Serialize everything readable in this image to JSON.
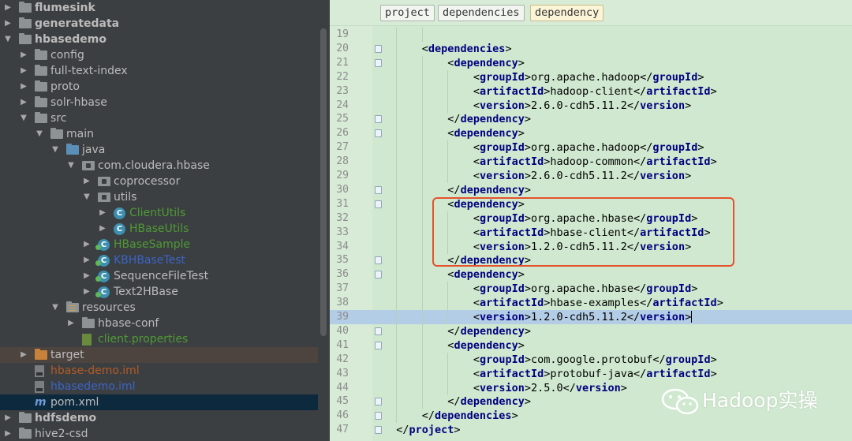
{
  "project_tree": {
    "items": [
      {
        "label": "flumesink",
        "depth": 0,
        "icon": "module-folder-icon",
        "expanded": false,
        "bold": true
      },
      {
        "label": "generatedata",
        "depth": 0,
        "icon": "module-folder-icon",
        "expanded": false,
        "bold": true
      },
      {
        "label": "hbasedemo",
        "depth": 0,
        "icon": "module-folder-icon",
        "expanded": true,
        "bold": true
      },
      {
        "label": "config",
        "depth": 1,
        "icon": "folder-icon",
        "expanded": false
      },
      {
        "label": "full-text-index",
        "depth": 1,
        "icon": "folder-icon",
        "expanded": false
      },
      {
        "label": "proto",
        "depth": 1,
        "icon": "folder-icon",
        "expanded": false
      },
      {
        "label": "solr-hbase",
        "depth": 1,
        "icon": "folder-icon",
        "expanded": false
      },
      {
        "label": "src",
        "depth": 1,
        "icon": "folder-icon",
        "expanded": true
      },
      {
        "label": "main",
        "depth": 2,
        "icon": "folder-icon",
        "expanded": true
      },
      {
        "label": "java",
        "depth": 3,
        "icon": "source-folder-icon",
        "expanded": true
      },
      {
        "label": "com.cloudera.hbase",
        "depth": 4,
        "icon": "package-icon",
        "expanded": true
      },
      {
        "label": "coprocessor",
        "depth": 5,
        "icon": "package-icon",
        "expanded": false
      },
      {
        "label": "utils",
        "depth": 5,
        "icon": "package-icon",
        "expanded": true
      },
      {
        "label": "ClientUtils",
        "depth": 6,
        "icon": "class-icon",
        "expanded": false,
        "color": "green"
      },
      {
        "label": "HBaseUtils",
        "depth": 6,
        "icon": "class-icon",
        "expanded": false,
        "color": "green"
      },
      {
        "label": "HBaseSample",
        "depth": 5,
        "icon": "runnable-class-icon",
        "expanded": false,
        "color": "green"
      },
      {
        "label": "KBHBaseTest",
        "depth": 5,
        "icon": "runnable-class-icon",
        "expanded": false,
        "color": "blue"
      },
      {
        "label": "SequenceFileTest",
        "depth": 5,
        "icon": "runnable-class-icon",
        "expanded": false
      },
      {
        "label": "Text2HBase",
        "depth": 5,
        "icon": "runnable-class-icon",
        "expanded": false
      },
      {
        "label": "resources",
        "depth": 3,
        "icon": "resources-folder-icon",
        "expanded": true
      },
      {
        "label": "hbase-conf",
        "depth": 4,
        "icon": "folder-icon",
        "expanded": false
      },
      {
        "label": "client.properties",
        "depth": 4,
        "icon": "properties-file-icon",
        "color": "green"
      },
      {
        "label": "target",
        "depth": 1,
        "icon": "excluded-folder-icon",
        "expanded": false,
        "excluded": true
      },
      {
        "label": "hbase-demo.iml",
        "depth": 1,
        "icon": "iml-file-icon",
        "color": "brown"
      },
      {
        "label": "hbasedemo.iml",
        "depth": 1,
        "icon": "iml-file-icon",
        "color": "blue"
      },
      {
        "label": "pom.xml",
        "depth": 1,
        "icon": "maven-file-icon",
        "selected": true
      },
      {
        "label": "hdfsdemo",
        "depth": 0,
        "icon": "module-folder-icon",
        "expanded": false,
        "bold": true
      },
      {
        "label": "hive2-csd",
        "depth": 0,
        "icon": "folder-icon",
        "expanded": false
      }
    ]
  },
  "editor": {
    "breadcrumbs": [
      "project",
      "dependencies",
      "dependency"
    ],
    "current_line": 39,
    "lines": [
      {
        "n": 19,
        "indent": 2,
        "parts": [
          {
            "t": "",
            "k": "text"
          }
        ],
        "fold": false
      },
      {
        "n": 20,
        "indent": 1,
        "parts": [
          {
            "t": "<",
            "k": "text"
          },
          {
            "t": "dependencies",
            "k": "tag"
          },
          {
            "t": ">",
            "k": "text"
          }
        ],
        "fold": true
      },
      {
        "n": 21,
        "indent": 2,
        "parts": [
          {
            "t": "<",
            "k": "text"
          },
          {
            "t": "dependency",
            "k": "tag"
          },
          {
            "t": ">",
            "k": "text"
          }
        ],
        "fold": true
      },
      {
        "n": 22,
        "indent": 3,
        "parts": [
          {
            "t": "<",
            "k": "text"
          },
          {
            "t": "groupId",
            "k": "tag"
          },
          {
            "t": ">org.apache.hadoop</",
            "k": "text"
          },
          {
            "t": "groupId",
            "k": "tag"
          },
          {
            "t": ">",
            "k": "text"
          }
        ],
        "fold": false
      },
      {
        "n": 23,
        "indent": 3,
        "parts": [
          {
            "t": "<",
            "k": "text"
          },
          {
            "t": "artifactId",
            "k": "tag"
          },
          {
            "t": ">hadoop-client</",
            "k": "text"
          },
          {
            "t": "artifactId",
            "k": "tag"
          },
          {
            "t": ">",
            "k": "text"
          }
        ],
        "fold": false
      },
      {
        "n": 24,
        "indent": 3,
        "parts": [
          {
            "t": "<",
            "k": "text"
          },
          {
            "t": "version",
            "k": "tag"
          },
          {
            "t": ">2.6.0-cdh5.11.2</",
            "k": "text"
          },
          {
            "t": "version",
            "k": "tag"
          },
          {
            "t": ">",
            "k": "text"
          }
        ],
        "fold": false
      },
      {
        "n": 25,
        "indent": 2,
        "parts": [
          {
            "t": "</",
            "k": "text"
          },
          {
            "t": "dependency",
            "k": "tag"
          },
          {
            "t": ">",
            "k": "text"
          }
        ],
        "fold": true
      },
      {
        "n": 26,
        "indent": 2,
        "parts": [
          {
            "t": "<",
            "k": "text"
          },
          {
            "t": "dependency",
            "k": "tag"
          },
          {
            "t": ">",
            "k": "text"
          }
        ],
        "fold": true
      },
      {
        "n": 27,
        "indent": 3,
        "parts": [
          {
            "t": "<",
            "k": "text"
          },
          {
            "t": "groupId",
            "k": "tag"
          },
          {
            "t": ">org.apache.hadoop</",
            "k": "text"
          },
          {
            "t": "groupId",
            "k": "tag"
          },
          {
            "t": ">",
            "k": "text"
          }
        ],
        "fold": false
      },
      {
        "n": 28,
        "indent": 3,
        "parts": [
          {
            "t": "<",
            "k": "text"
          },
          {
            "t": "artifactId",
            "k": "tag"
          },
          {
            "t": ">hadoop-common</",
            "k": "text"
          },
          {
            "t": "artifactId",
            "k": "tag"
          },
          {
            "t": ">",
            "k": "text"
          }
        ],
        "fold": false
      },
      {
        "n": 29,
        "indent": 3,
        "parts": [
          {
            "t": "<",
            "k": "text"
          },
          {
            "t": "version",
            "k": "tag"
          },
          {
            "t": ">2.6.0-cdh5.11.2</",
            "k": "text"
          },
          {
            "t": "version",
            "k": "tag"
          },
          {
            "t": ">",
            "k": "text"
          }
        ],
        "fold": false
      },
      {
        "n": 30,
        "indent": 2,
        "parts": [
          {
            "t": "</",
            "k": "text"
          },
          {
            "t": "dependency",
            "k": "tag"
          },
          {
            "t": ">",
            "k": "text"
          }
        ],
        "fold": true
      },
      {
        "n": 31,
        "indent": 2,
        "parts": [
          {
            "t": "<",
            "k": "text"
          },
          {
            "t": "dependency",
            "k": "tag"
          },
          {
            "t": ">",
            "k": "text"
          }
        ],
        "fold": true
      },
      {
        "n": 32,
        "indent": 3,
        "parts": [
          {
            "t": "<",
            "k": "text"
          },
          {
            "t": "groupId",
            "k": "tag"
          },
          {
            "t": ">org.apache.hbase</",
            "k": "text"
          },
          {
            "t": "groupId",
            "k": "tag"
          },
          {
            "t": ">",
            "k": "text"
          }
        ],
        "fold": false
      },
      {
        "n": 33,
        "indent": 3,
        "parts": [
          {
            "t": "<",
            "k": "text"
          },
          {
            "t": "artifactId",
            "k": "tag"
          },
          {
            "t": ">hbase-client</",
            "k": "text"
          },
          {
            "t": "artifactId",
            "k": "tag"
          },
          {
            "t": ">",
            "k": "text"
          }
        ],
        "fold": false
      },
      {
        "n": 34,
        "indent": 3,
        "parts": [
          {
            "t": "<",
            "k": "text"
          },
          {
            "t": "version",
            "k": "tag"
          },
          {
            "t": ">1.2.0-cdh5.11.2</",
            "k": "text"
          },
          {
            "t": "version",
            "k": "tag"
          },
          {
            "t": ">",
            "k": "text"
          }
        ],
        "fold": false
      },
      {
        "n": 35,
        "indent": 2,
        "parts": [
          {
            "t": "</",
            "k": "text"
          },
          {
            "t": "dependency",
            "k": "tag"
          },
          {
            "t": ">",
            "k": "text"
          }
        ],
        "fold": true
      },
      {
        "n": 36,
        "indent": 2,
        "parts": [
          {
            "t": "<",
            "k": "text"
          },
          {
            "t": "dependency",
            "k": "tag"
          },
          {
            "t": ">",
            "k": "text"
          }
        ],
        "fold": true
      },
      {
        "n": 37,
        "indent": 3,
        "parts": [
          {
            "t": "<",
            "k": "text"
          },
          {
            "t": "groupId",
            "k": "tag"
          },
          {
            "t": ">org.apache.hbase</",
            "k": "text"
          },
          {
            "t": "groupId",
            "k": "tag"
          },
          {
            "t": ">",
            "k": "text"
          }
        ],
        "fold": false
      },
      {
        "n": 38,
        "indent": 3,
        "parts": [
          {
            "t": "<",
            "k": "text"
          },
          {
            "t": "artifactId",
            "k": "tag"
          },
          {
            "t": ">hbase-examples</",
            "k": "text"
          },
          {
            "t": "artifactId",
            "k": "tag"
          },
          {
            "t": ">",
            "k": "text"
          }
        ],
        "fold": false
      },
      {
        "n": 39,
        "indent": 3,
        "parts": [
          {
            "t": "<",
            "k": "text"
          },
          {
            "t": "version",
            "k": "tag"
          },
          {
            "t": ">1.2.0-cdh5.11.2</",
            "k": "text"
          },
          {
            "t": "version",
            "k": "tag"
          },
          {
            "t": ">",
            "k": "text"
          }
        ],
        "fold": false,
        "caret": true
      },
      {
        "n": 40,
        "indent": 2,
        "parts": [
          {
            "t": "</",
            "k": "text"
          },
          {
            "t": "dependency",
            "k": "tag"
          },
          {
            "t": ">",
            "k": "text"
          }
        ],
        "fold": true
      },
      {
        "n": 41,
        "indent": 2,
        "parts": [
          {
            "t": "<",
            "k": "text"
          },
          {
            "t": "dependency",
            "k": "tag"
          },
          {
            "t": ">",
            "k": "text"
          }
        ],
        "fold": true
      },
      {
        "n": 42,
        "indent": 3,
        "parts": [
          {
            "t": "<",
            "k": "text"
          },
          {
            "t": "groupId",
            "k": "tag"
          },
          {
            "t": ">com.google.protobuf</",
            "k": "text"
          },
          {
            "t": "groupId",
            "k": "tag"
          },
          {
            "t": ">",
            "k": "text"
          }
        ],
        "fold": false
      },
      {
        "n": 43,
        "indent": 3,
        "parts": [
          {
            "t": "<",
            "k": "text"
          },
          {
            "t": "artifactId",
            "k": "tag"
          },
          {
            "t": ">protobuf-java</",
            "k": "text"
          },
          {
            "t": "artifactId",
            "k": "tag"
          },
          {
            "t": ">",
            "k": "text"
          }
        ],
        "fold": false
      },
      {
        "n": 44,
        "indent": 3,
        "parts": [
          {
            "t": "<",
            "k": "text"
          },
          {
            "t": "version",
            "k": "tag"
          },
          {
            "t": ">2.5.0</",
            "k": "text"
          },
          {
            "t": "version",
            "k": "tag"
          },
          {
            "t": ">",
            "k": "text"
          }
        ],
        "fold": false
      },
      {
        "n": 45,
        "indent": 2,
        "parts": [
          {
            "t": "</",
            "k": "text"
          },
          {
            "t": "dependency",
            "k": "tag"
          },
          {
            "t": ">",
            "k": "text"
          }
        ],
        "fold": true
      },
      {
        "n": 46,
        "indent": 1,
        "parts": [
          {
            "t": "</",
            "k": "text"
          },
          {
            "t": "dependencies",
            "k": "tag"
          },
          {
            "t": ">",
            "k": "text"
          }
        ],
        "fold": true
      },
      {
        "n": 47,
        "indent": 0,
        "parts": [
          {
            "t": "</",
            "k": "text"
          },
          {
            "t": "project",
            "k": "tag"
          },
          {
            "t": ">",
            "k": "text"
          }
        ],
        "fold": true
      }
    ]
  },
  "watermark": {
    "text": "Hadoop实操",
    "icon": "wechat-icon"
  },
  "colors": {
    "highlight_box": "#e5522d",
    "editor_bg": "#cfe8cf",
    "tag": "#000080",
    "tree_bg": "#3c3f41"
  }
}
